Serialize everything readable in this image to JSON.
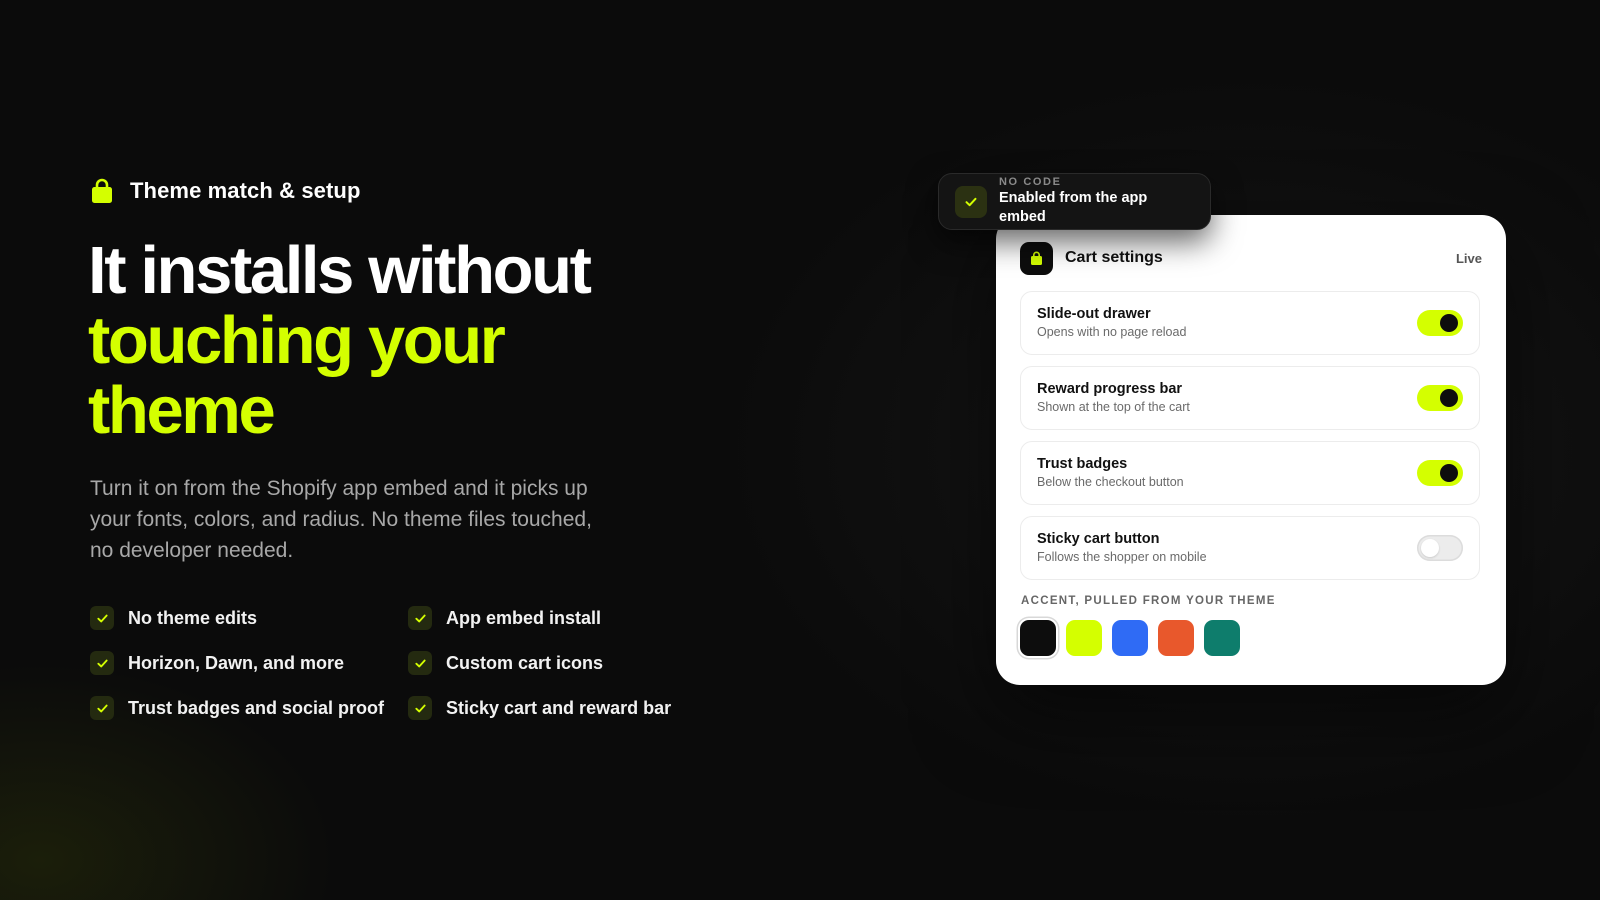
{
  "eyebrow": {
    "icon": "shopping-bag-icon",
    "label": "Theme match & setup"
  },
  "headline": {
    "line1": "It installs without",
    "line2": "touching your",
    "line3": "theme"
  },
  "subtitle": "Turn it on from the Shopify app embed and it picks up your fonts, colors, and radius. No theme files touched, no developer needed.",
  "features": [
    {
      "label": "No theme edits",
      "icon": "check-icon"
    },
    {
      "label": "App embed install",
      "icon": "check-icon"
    },
    {
      "label": "Horizon, Dawn, and more",
      "icon": "check-icon"
    },
    {
      "label": "Custom cart icons",
      "icon": "check-icon"
    },
    {
      "label": "Trust badges and social proof",
      "icon": "check-icon"
    },
    {
      "label": "Sticky cart and reward bar",
      "icon": "check-icon"
    }
  ],
  "badge": {
    "icon": "check-icon",
    "kicker": "NO CODE",
    "title": "Enabled from the app embed"
  },
  "card": {
    "icon": "shopping-bag-icon",
    "title": "Cart settings",
    "status": "Live",
    "settings": [
      {
        "title": "Slide-out drawer",
        "subtitle": "Opens with no page reload",
        "enabled": true
      },
      {
        "title": "Reward progress bar",
        "subtitle": "Shown at the top of the cart",
        "enabled": true
      },
      {
        "title": "Trust badges",
        "subtitle": "Below the checkout button",
        "enabled": true
      },
      {
        "title": "Sticky cart button",
        "subtitle": "Follows the shopper on mobile",
        "enabled": false
      }
    ],
    "accent_label": "ACCENT, PULLED FROM YOUR THEME",
    "accent_colors": [
      "#0d0d0d",
      "#d4ff00",
      "#2f6bf5",
      "#e8582c",
      "#0e7d6c"
    ],
    "selected_accent": 0
  },
  "colors": {
    "background": "#0b0b0b",
    "accent": "#d4ff00",
    "text_muted": "#a8a8a8"
  }
}
